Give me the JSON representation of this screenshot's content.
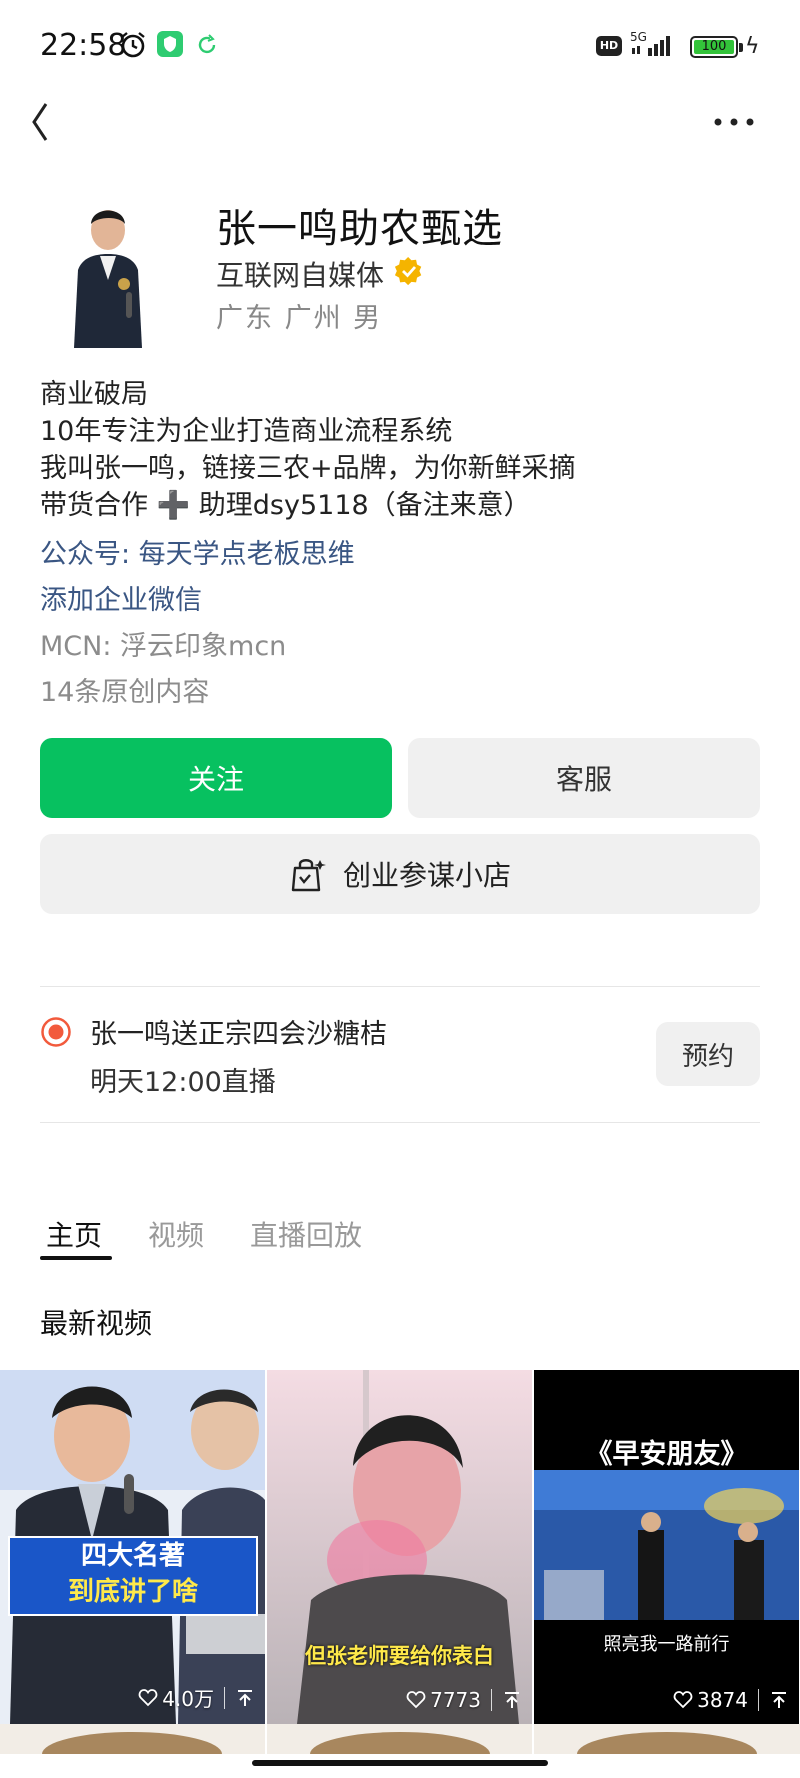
{
  "status_bar": {
    "time": "22:58",
    "network": "5G",
    "hd_label": "HD",
    "battery": "100"
  },
  "profile": {
    "name": "张一鸣助农甄选",
    "category": "互联网自媒体",
    "location": "广东 广州 男"
  },
  "bio": {
    "lines": [
      "商业破局",
      "10年专注为企业打造商业流程系统",
      "我叫张一鸣，链接三农+品牌，为你新鲜采摘",
      "带货合作 ➕ 助理dsy5118（备注来意）"
    ],
    "official_account": "公众号: 每天学点老板思维",
    "add_wecom": "添加企业微信",
    "mcn": "MCN: 浮云印象mcn",
    "original_count": "14条原创内容"
  },
  "actions": {
    "follow_label": "关注",
    "service_label": "客服",
    "shop_label": "创业参谋小店"
  },
  "live": {
    "title": "张一鸣送正宗四会沙糖桔",
    "time": "明天12:00直播",
    "reserve_label": "预约"
  },
  "tabs": [
    {
      "label": "主页",
      "active": true
    },
    {
      "label": "视频",
      "active": false
    },
    {
      "label": "直播回放",
      "active": false
    }
  ],
  "section_title": "最新视频",
  "videos": [
    {
      "caption_line1": "四大名著",
      "caption_line2": "到底讲了啥",
      "likes": "4.0万"
    },
    {
      "caption": "但张老师要给你表白",
      "likes": "7773"
    },
    {
      "title": "《早安朋友》",
      "subtitle": "照亮我一路前行",
      "likes": "3874"
    }
  ],
  "colors": {
    "accent_green": "#07c160",
    "link_blue": "#3a5683",
    "verified_gold": "#f5b400",
    "live_red": "#f25a3c"
  },
  "icons": [
    "back-icon",
    "more-icon",
    "verified-icon",
    "shop-bag-icon",
    "live-icon",
    "heart-icon",
    "pin-icon"
  ]
}
